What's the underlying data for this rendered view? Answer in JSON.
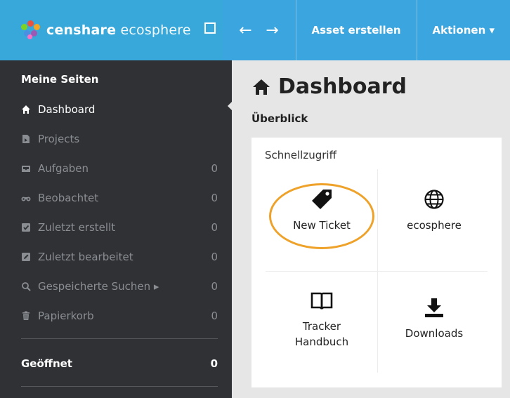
{
  "topbar": {
    "brand_bold": "censhare",
    "brand_light": "ecosphere",
    "back_arrow": "←",
    "forward_arrow": "→",
    "create_asset": "Asset erstellen",
    "actions": "Aktionen ▾"
  },
  "sidebar": {
    "section_mine": "Meine Seiten",
    "items": [
      {
        "label": "Dashboard",
        "count": "",
        "icon": "home-icon"
      },
      {
        "label": "Projects",
        "count": "",
        "icon": "project-icon"
      },
      {
        "label": "Aufgaben",
        "count": "0",
        "icon": "inbox-icon"
      },
      {
        "label": "Beobachtet",
        "count": "0",
        "icon": "binoculars-icon"
      },
      {
        "label": "Zuletzt erstellt",
        "count": "0",
        "icon": "created-icon"
      },
      {
        "label": "Zuletzt bearbeitet",
        "count": "0",
        "icon": "edit-icon"
      },
      {
        "label": "Gespeicherte Suchen ▸",
        "count": "0",
        "icon": "search-icon"
      },
      {
        "label": "Papierkorb",
        "count": "0",
        "icon": "trash-icon"
      }
    ],
    "section_open": "Geöffnet",
    "section_open_count": "0"
  },
  "main": {
    "title": "Dashboard",
    "subtitle": "Überblick",
    "card_title": "Schnellzugriff",
    "tiles": [
      {
        "label": "New Ticket",
        "icon": "tag-icon"
      },
      {
        "label": "ecosphere",
        "icon": "globe-icon"
      },
      {
        "label": "Tracker\nHandbuch",
        "icon": "book-icon"
      },
      {
        "label": "Downloads",
        "icon": "download-icon"
      }
    ]
  },
  "colors": {
    "brand_bar": "#37a8d9",
    "toolbar": "#3aa5de",
    "sidebar_bg": "#2f3135",
    "highlight": "#eea22a"
  }
}
